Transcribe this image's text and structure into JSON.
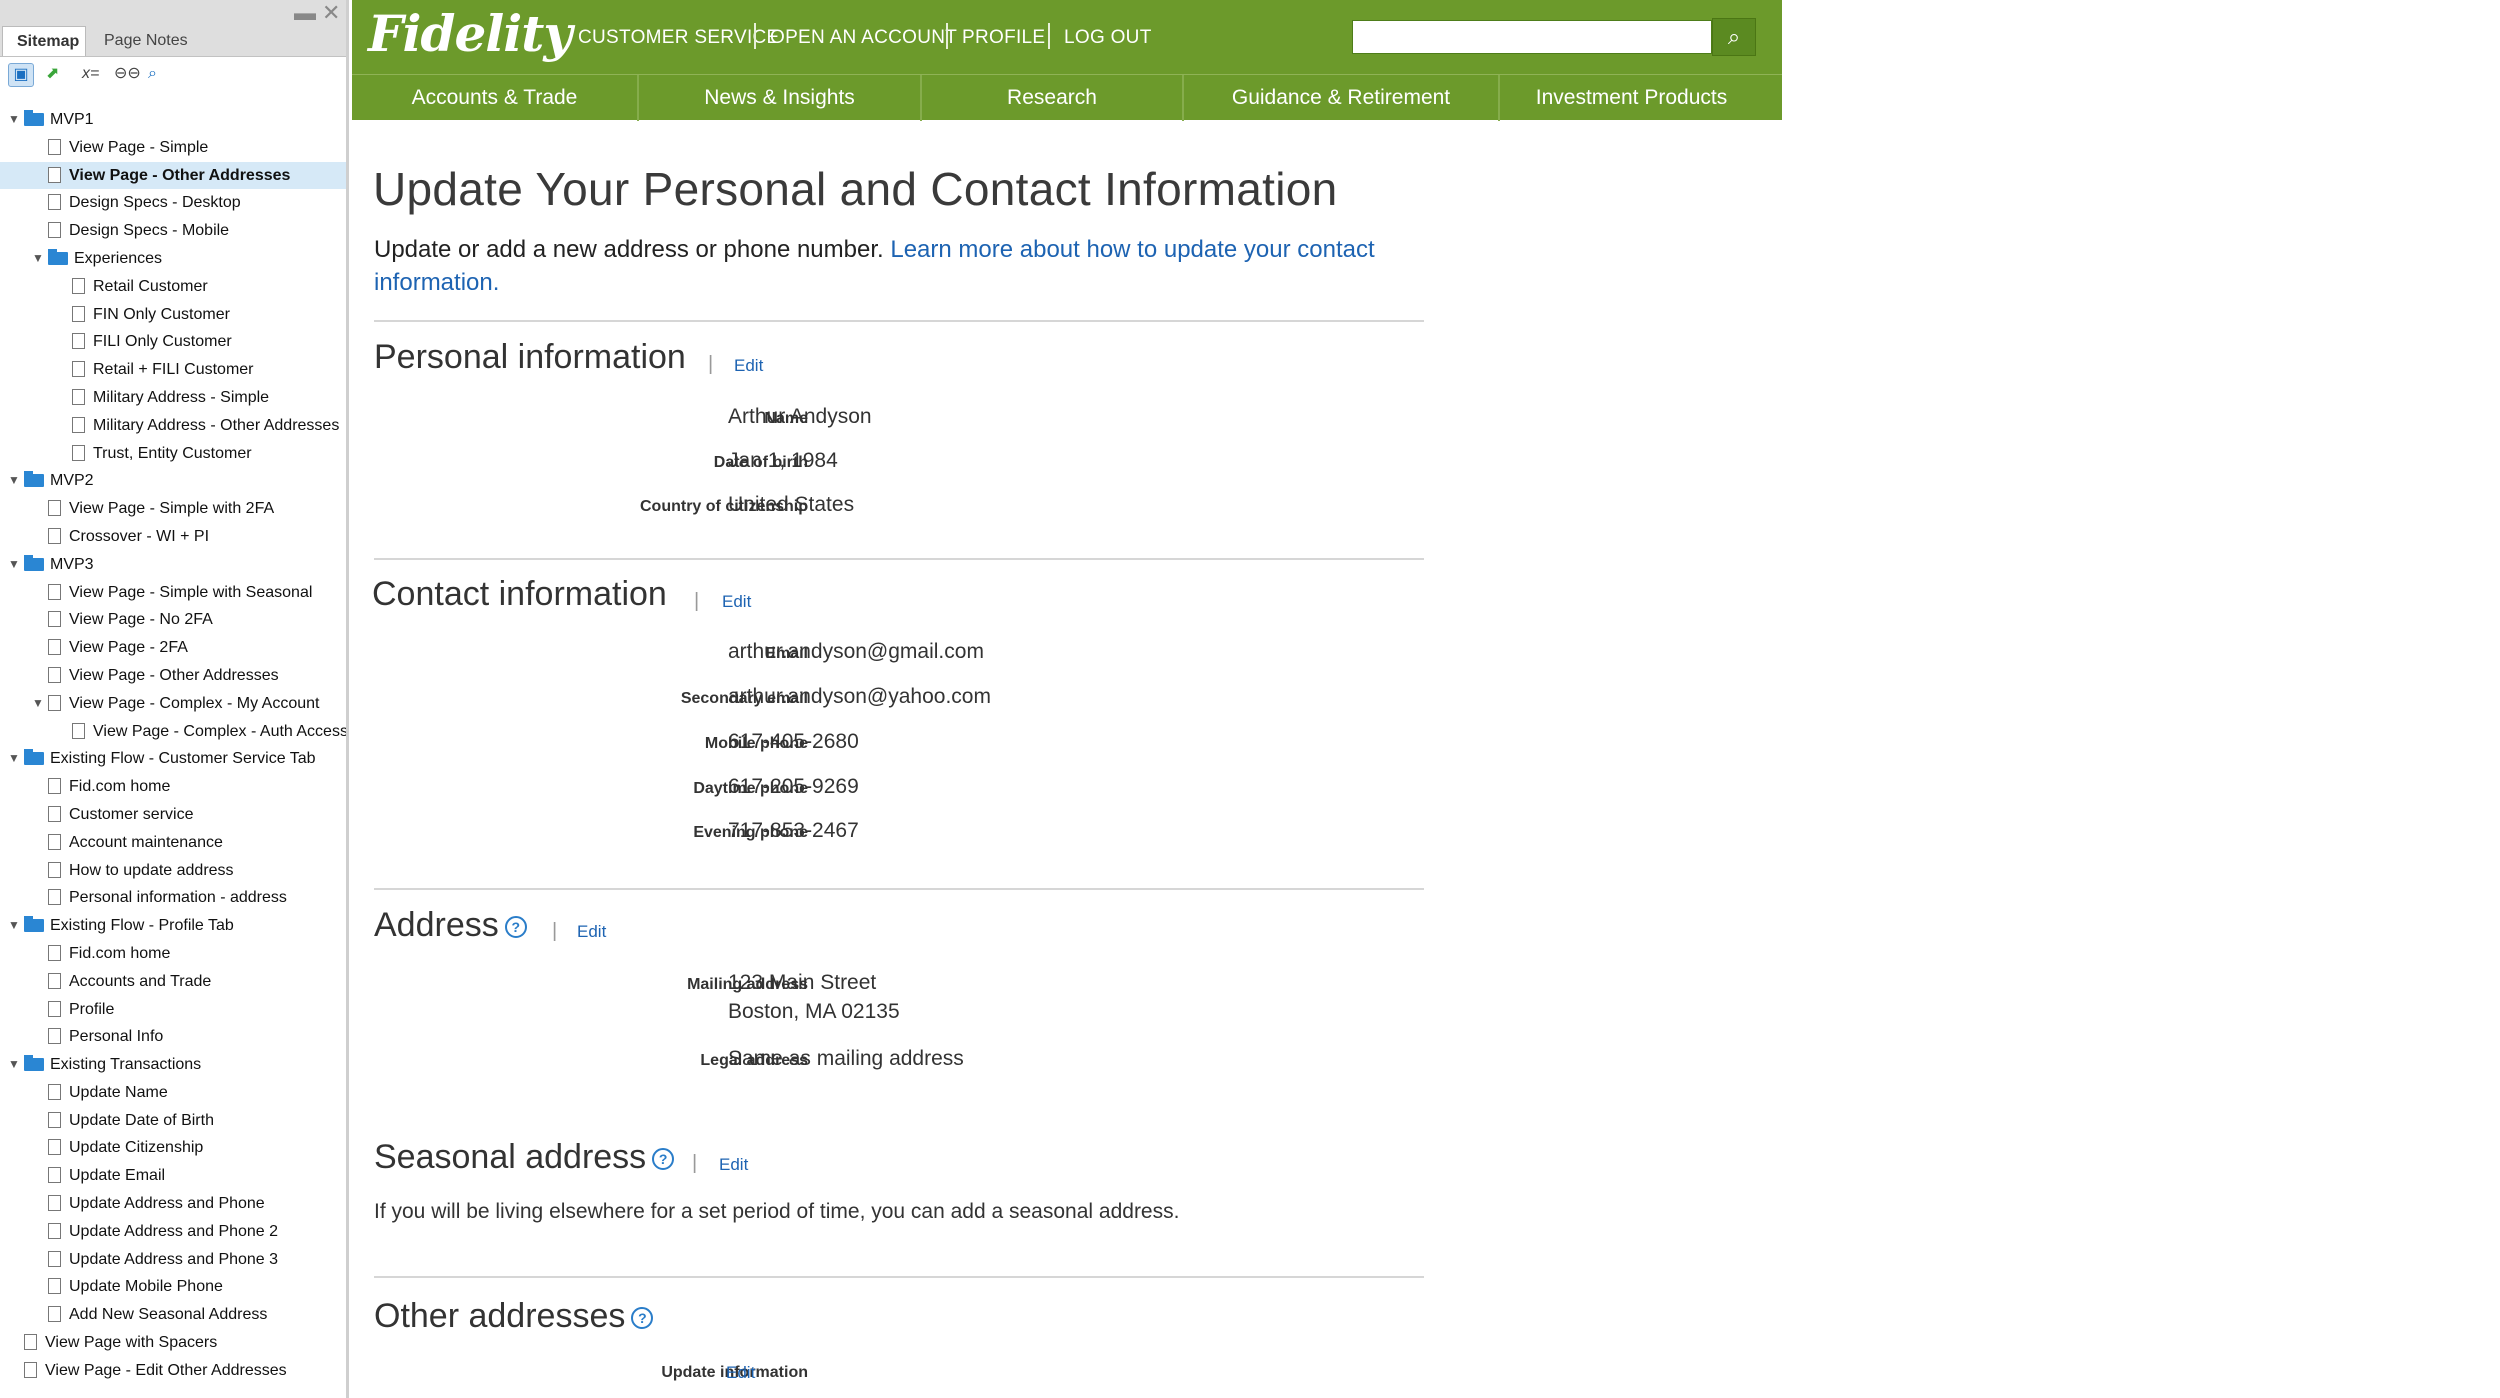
{
  "sitemap": {
    "tabs": [
      "Sitemap",
      "Page Notes"
    ],
    "tree": [
      {
        "label": "MVP1",
        "type": "folder",
        "level": 0,
        "expanded": true
      },
      {
        "label": "View Page - Simple",
        "type": "page",
        "level": 1
      },
      {
        "label": "View Page - Other Addresses",
        "type": "page",
        "level": 1,
        "selected": true
      },
      {
        "label": "Design Specs - Desktop",
        "type": "page",
        "level": 1
      },
      {
        "label": "Design Specs - Mobile",
        "type": "page",
        "level": 1
      },
      {
        "label": "Experiences",
        "type": "folder",
        "level": 1,
        "expanded": true
      },
      {
        "label": "Retail Customer",
        "type": "page",
        "level": 2
      },
      {
        "label": "FIN Only Customer",
        "type": "page",
        "level": 2
      },
      {
        "label": "FILI Only Customer",
        "type": "page",
        "level": 2
      },
      {
        "label": "Retail + FILI Customer",
        "type": "page",
        "level": 2
      },
      {
        "label": "Military Address - Simple",
        "type": "page",
        "level": 2
      },
      {
        "label": "Military Address - Other Addresses",
        "type": "page",
        "level": 2
      },
      {
        "label": "Trust, Entity Customer",
        "type": "page",
        "level": 2
      },
      {
        "label": "MVP2",
        "type": "folder",
        "level": 0,
        "expanded": true
      },
      {
        "label": "View Page - Simple with 2FA",
        "type": "page",
        "level": 1
      },
      {
        "label": "Crossover - WI + PI",
        "type": "page",
        "level": 1
      },
      {
        "label": "MVP3",
        "type": "folder",
        "level": 0,
        "expanded": true
      },
      {
        "label": "View Page - Simple with Seasonal",
        "type": "page",
        "level": 1
      },
      {
        "label": "View Page - No 2FA",
        "type": "page",
        "level": 1
      },
      {
        "label": "View Page - 2FA",
        "type": "page",
        "level": 1
      },
      {
        "label": "View Page - Other Addresses",
        "type": "page",
        "level": 1
      },
      {
        "label": "View Page - Complex - My Account",
        "type": "page",
        "level": 1,
        "expanded": true
      },
      {
        "label": "View Page - Complex - Auth Access",
        "type": "page",
        "level": 2
      },
      {
        "label": "Existing Flow - Customer Service Tab",
        "type": "folder",
        "level": 0,
        "expanded": true
      },
      {
        "label": "Fid.com home",
        "type": "page",
        "level": 1
      },
      {
        "label": "Customer service",
        "type": "page",
        "level": 1
      },
      {
        "label": "Account maintenance",
        "type": "page",
        "level": 1
      },
      {
        "label": "How to update address",
        "type": "page",
        "level": 1
      },
      {
        "label": "Personal information - address",
        "type": "page",
        "level": 1
      },
      {
        "label": "Existing Flow - Profile Tab",
        "type": "folder",
        "level": 0,
        "expanded": true
      },
      {
        "label": "Fid.com home",
        "type": "page",
        "level": 1
      },
      {
        "label": "Accounts and Trade",
        "type": "page",
        "level": 1
      },
      {
        "label": "Profile",
        "type": "page",
        "level": 1
      },
      {
        "label": "Personal Info",
        "type": "page",
        "level": 1
      },
      {
        "label": "Existing Transactions",
        "type": "folder",
        "level": 0,
        "expanded": true
      },
      {
        "label": "Update Name",
        "type": "page",
        "level": 1
      },
      {
        "label": "Update Date of Birth",
        "type": "page",
        "level": 1
      },
      {
        "label": "Update Citizenship",
        "type": "page",
        "level": 1
      },
      {
        "label": "Update Email",
        "type": "page",
        "level": 1
      },
      {
        "label": "Update Address and Phone",
        "type": "page",
        "level": 1
      },
      {
        "label": "Update Address and Phone 2",
        "type": "page",
        "level": 1
      },
      {
        "label": "Update Address and Phone 3",
        "type": "page",
        "level": 1
      },
      {
        "label": "Update Mobile Phone",
        "type": "page",
        "level": 1
      },
      {
        "label": "Add New Seasonal Address",
        "type": "page",
        "level": 1
      },
      {
        "label": "View Page with Spacers",
        "type": "page",
        "level": 0
      },
      {
        "label": "View Page - Edit Other Addresses",
        "type": "page",
        "level": 0
      }
    ]
  },
  "header": {
    "logo": "Fidelity",
    "util_links": [
      "CUSTOMER SERVICE",
      "OPEN AN ACCOUNT",
      "PROFILE",
      "LOG OUT"
    ],
    "search_placeholder": "",
    "nav": [
      "Accounts & Trade",
      "News & Insights",
      "Research",
      "Guidance & Retirement",
      "Investment Products"
    ],
    "brand_color": "#6c9a2b"
  },
  "page": {
    "title": "Update Your Personal and Contact Information",
    "intro_text": "Update or add a new address or phone number. ",
    "intro_link": "Learn more about how to update your contact information."
  },
  "sections": {
    "personal": {
      "title": "Personal information",
      "edit": "Edit",
      "fields": [
        {
          "label": "Name",
          "value": "Arthur Andyson"
        },
        {
          "label": "Date of birth",
          "value": "Jan 1, 1984"
        },
        {
          "label": "Country of citizenship",
          "value": "United States"
        }
      ]
    },
    "contact": {
      "title": "Contact information",
      "edit": "Edit",
      "fields": [
        {
          "label": "Email",
          "value": "arthur.andyson@gmail.com"
        },
        {
          "label": "Secondary email",
          "value": "arthur.andyson@yahoo.com"
        },
        {
          "label": "Mobile phone",
          "value": "617-405-2680"
        },
        {
          "label": "Daytime phone",
          "value": "617-205-9269"
        },
        {
          "label": "Evening phone",
          "value": "717-853-2467"
        }
      ]
    },
    "address": {
      "title": "Address",
      "edit": "Edit",
      "mailing_label": "Mailing address",
      "mailing_line1": "123 Main Street",
      "mailing_line2": "Boston, MA 02135",
      "legal_label": "Legal address",
      "legal_value": "Same as mailing address"
    },
    "seasonal": {
      "title": "Seasonal address",
      "edit": "Edit",
      "description": "If you will be living elsewhere for a set period of time, you can add a seasonal address."
    },
    "other": {
      "title": "Other addresses",
      "update_label": "Update information",
      "edit": "Edit"
    }
  }
}
